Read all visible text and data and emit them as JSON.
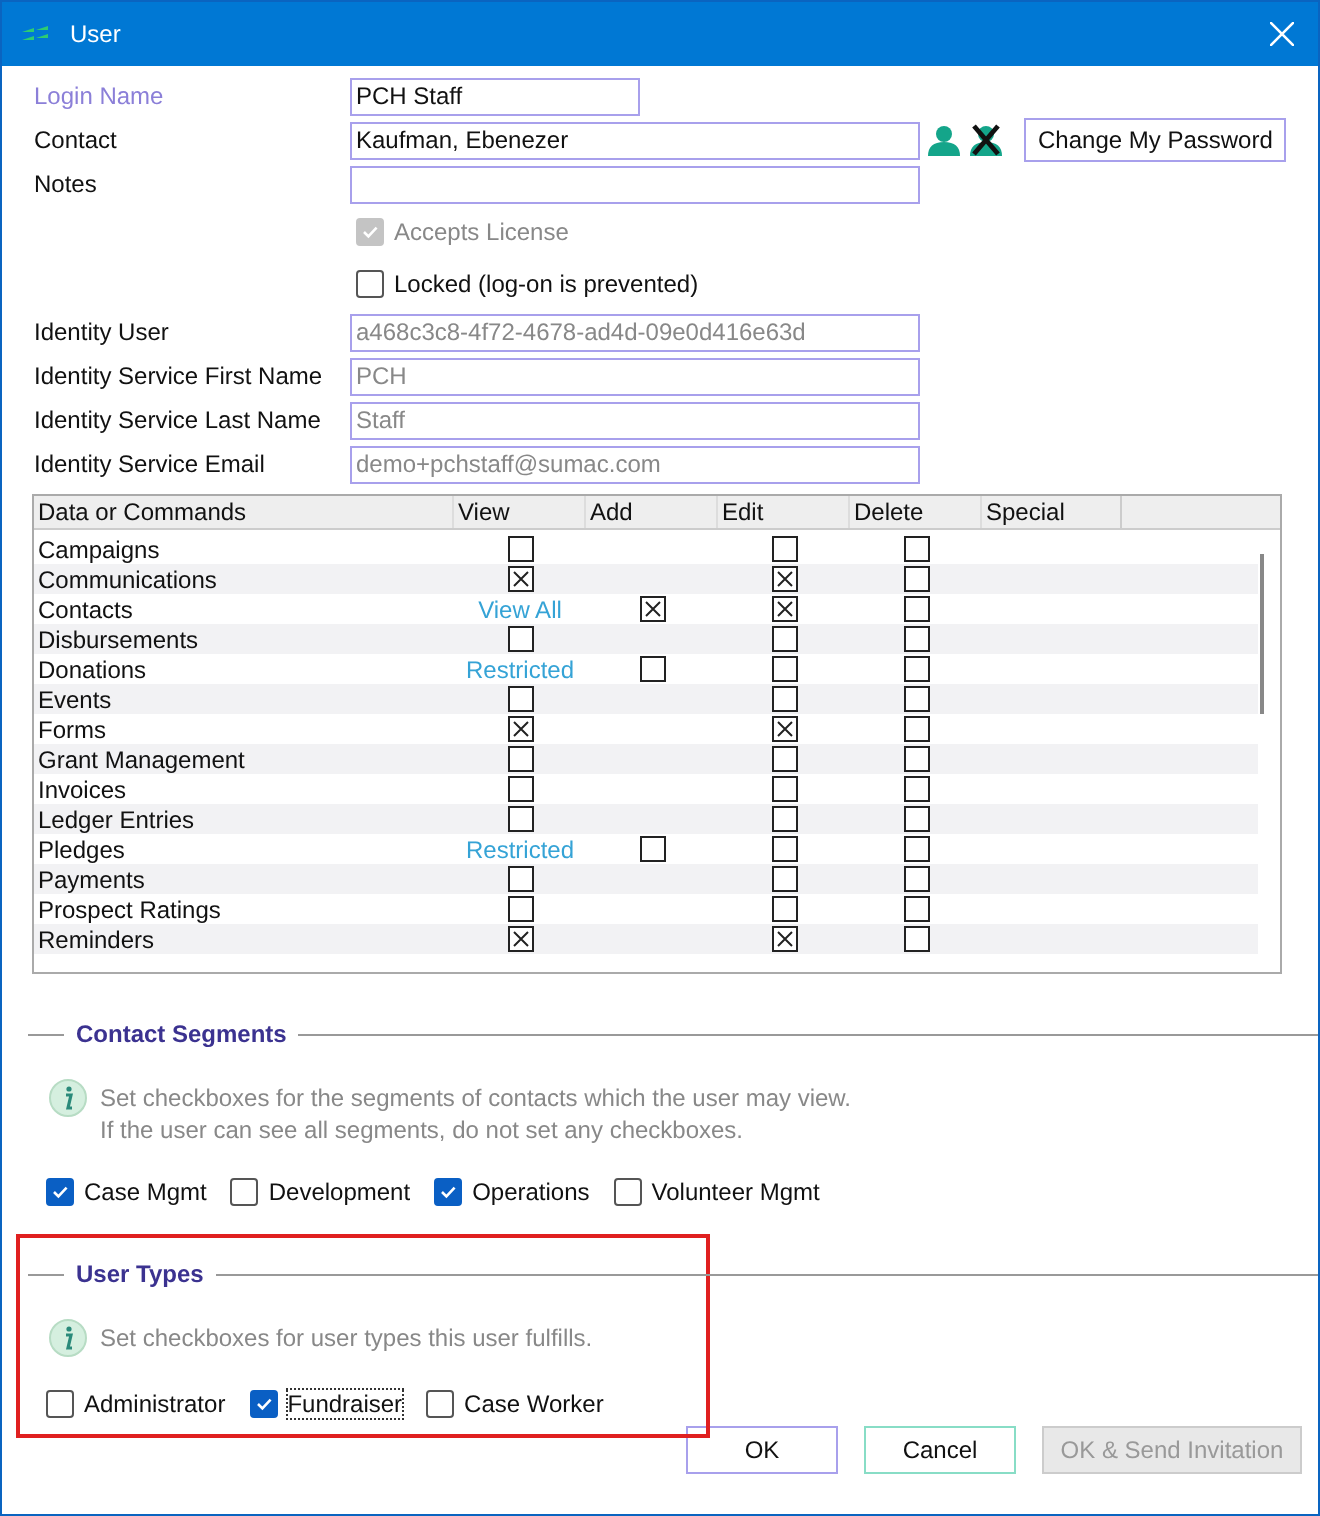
{
  "window": {
    "title": "User"
  },
  "form": {
    "login_name": {
      "label": "Login Name",
      "value": "PCH Staff"
    },
    "contact": {
      "label": "Contact",
      "value": "Kaufman, Ebenezer"
    },
    "change_password": "Change My Password",
    "notes": {
      "label": "Notes"
    },
    "accepts_license": {
      "label": "Accepts License",
      "checked": true,
      "disabled": true
    },
    "locked": {
      "label": "Locked (log-on is prevented)",
      "checked": false,
      "disabled": false
    },
    "identity": [
      {
        "label": "Identity User",
        "value": "a468c3c8-4f72-4678-ad4d-09e0d416e63d"
      },
      {
        "label": "Identity Service First Name",
        "value": "PCH"
      },
      {
        "label": "Identity Service Last Name",
        "value": "Staff"
      },
      {
        "label": "Identity Service Email",
        "value": "demo+pchstaff@sumac.com"
      }
    ]
  },
  "table": {
    "columns": [
      "Data or Commands",
      "View",
      "Add",
      "Edit",
      "Delete",
      "Special"
    ],
    "rows": [
      {
        "name": "Campaigns",
        "view": {
          "kind": "check",
          "checked": false
        },
        "edit": false,
        "delete": false
      },
      {
        "name": "Communications",
        "view": {
          "kind": "check",
          "checked": true
        },
        "edit": true,
        "delete": false
      },
      {
        "name": "Contacts",
        "view": {
          "kind": "link",
          "text": "View All"
        },
        "add": true,
        "edit": true,
        "delete": false
      },
      {
        "name": "Disbursements",
        "view": {
          "kind": "check",
          "checked": false
        },
        "edit": false,
        "delete": false
      },
      {
        "name": "Donations",
        "view": {
          "kind": "link",
          "text": "Restricted"
        },
        "add": false,
        "edit": false,
        "delete": false
      },
      {
        "name": "Events",
        "view": {
          "kind": "check",
          "checked": false
        },
        "edit": false,
        "delete": false
      },
      {
        "name": "Forms",
        "view": {
          "kind": "check",
          "checked": true
        },
        "edit": true,
        "delete": false
      },
      {
        "name": "Grant Management",
        "view": {
          "kind": "check",
          "checked": false
        },
        "edit": false,
        "delete": false
      },
      {
        "name": "Invoices",
        "view": {
          "kind": "check",
          "checked": false
        },
        "edit": false,
        "delete": false
      },
      {
        "name": "Ledger Entries",
        "view": {
          "kind": "check",
          "checked": false
        },
        "edit": false,
        "delete": false
      },
      {
        "name": "Pledges",
        "view": {
          "kind": "link",
          "text": "Restricted"
        },
        "add": false,
        "edit": false,
        "delete": false
      },
      {
        "name": "Payments",
        "view": {
          "kind": "check",
          "checked": false
        },
        "edit": false,
        "delete": false
      },
      {
        "name": "Prospect Ratings",
        "view": {
          "kind": "check",
          "checked": false
        },
        "edit": false,
        "delete": false
      },
      {
        "name": "Reminders",
        "view": {
          "kind": "check",
          "checked": true
        },
        "edit": true,
        "delete": false
      }
    ]
  },
  "contact_segments": {
    "title": "Contact Segments",
    "info": [
      "Set checkboxes for the segments of contacts which the user may view.",
      "If the user can see all segments, do not set any checkboxes."
    ],
    "options": [
      {
        "label": "Case Mgmt",
        "checked": true,
        "focused": false
      },
      {
        "label": "Development",
        "checked": false,
        "focused": false
      },
      {
        "label": "Operations",
        "checked": true,
        "focused": false
      },
      {
        "label": "Volunteer Mgmt",
        "checked": false,
        "focused": false
      }
    ]
  },
  "user_types": {
    "title": "User Types",
    "highlighted": true,
    "info": [
      "Set checkboxes for user types this user fulfills."
    ],
    "options": [
      {
        "label": "Administrator",
        "checked": false,
        "focused": false
      },
      {
        "label": "Fundraiser",
        "checked": true,
        "focused": true
      },
      {
        "label": "Case Worker",
        "checked": false,
        "focused": false
      }
    ]
  },
  "buttons": [
    {
      "label": "OK",
      "kind": "default",
      "disabled": false
    },
    {
      "label": "Cancel",
      "kind": "cancel",
      "disabled": false
    },
    {
      "label": "OK & Send Invitation",
      "kind": "plain",
      "disabled": true
    }
  ]
}
